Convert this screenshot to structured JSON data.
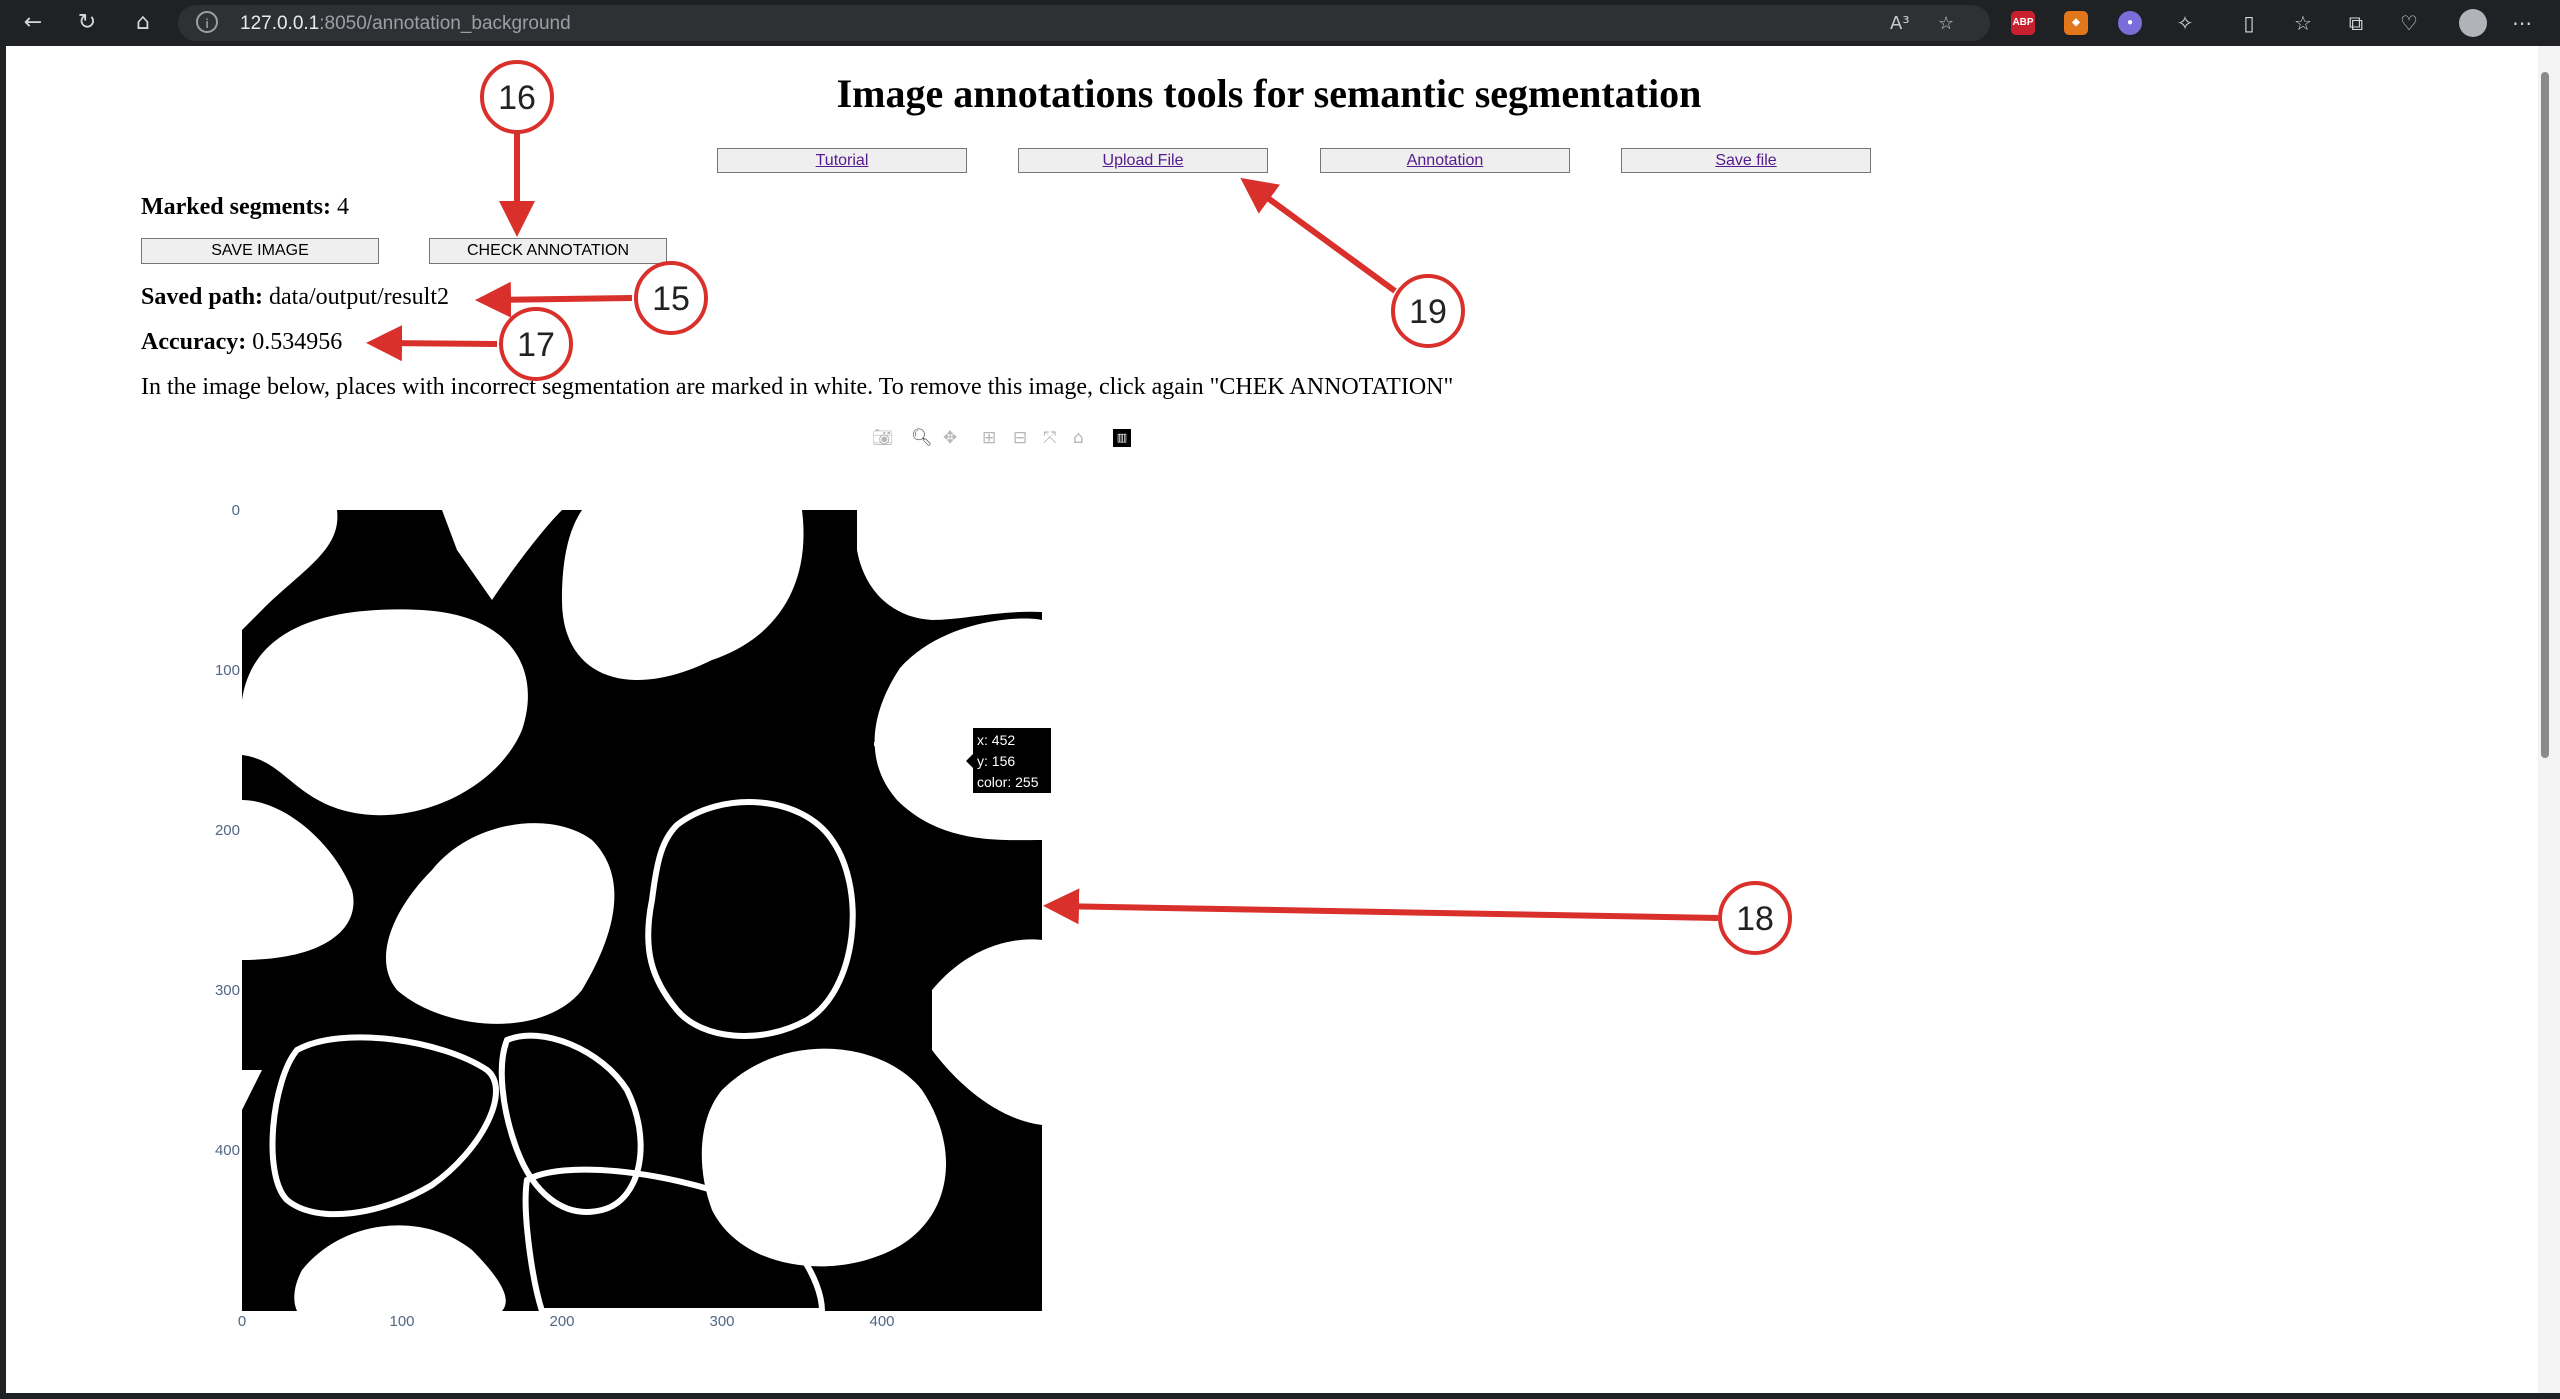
{
  "browser": {
    "url_host": "127.0.0.1",
    "url_path": ":8050/annotation_background",
    "reader_icon": "A³",
    "extensions": [
      "ABP"
    ]
  },
  "page": {
    "title": "Image annotations tools for semantic segmentation",
    "nav": [
      "Tutorial",
      "Upload File",
      "Annotation",
      "Save file"
    ],
    "marked_segments_label": "Marked segments:",
    "marked_segments_value": "4",
    "save_image_label": "SAVE IMAGE",
    "check_annotation_label": "CHECK ANNOTATION",
    "saved_path_label": "Saved path:",
    "saved_path_value": "data/output/result2",
    "accuracy_label": "Accuracy:",
    "accuracy_value": "0.534956",
    "info_text": "In the image below, places with incorrect segmentation are marked in white. To remove this image, click again \"CHEK ANNOTATION\""
  },
  "plot": {
    "x_ticks": [
      "0",
      "100",
      "200",
      "300",
      "400"
    ],
    "y_ticks": [
      "0",
      "100",
      "200",
      "300",
      "400"
    ],
    "x_range": [
      0,
      500
    ],
    "y_range": [
      0,
      500
    ],
    "hover": {
      "x": "x: 452",
      "y": "y: 156",
      "color": "color: 255"
    },
    "modebar_icons": [
      "camera-icon",
      "zoom-icon",
      "pan-icon",
      "zoom-in-icon",
      "zoom-out-icon",
      "autoscale-icon",
      "reset-axes-icon",
      "plotly-logo-icon"
    ]
  },
  "callouts": [
    "16",
    "15",
    "17",
    "19",
    "18"
  ],
  "colors": {
    "callout": "#d9302b",
    "link": "#551a8b",
    "chrome": "#202124"
  }
}
